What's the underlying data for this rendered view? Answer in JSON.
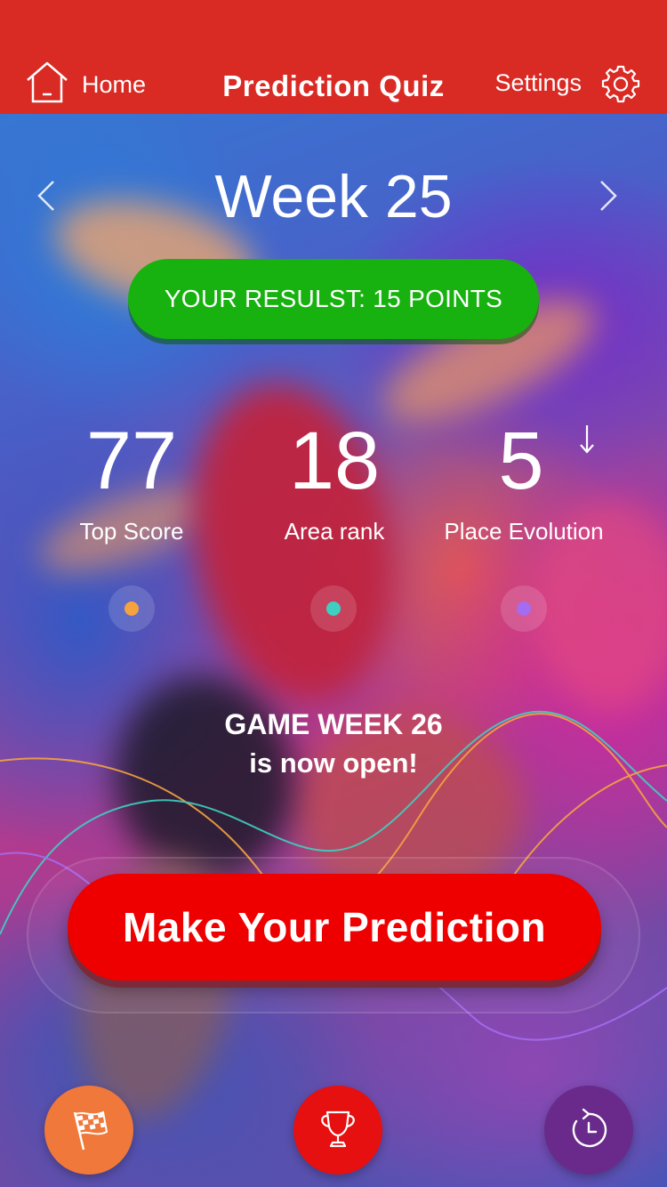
{
  "header": {
    "home_label": "Home",
    "title": "Prediction Quiz",
    "settings_label": "Settings",
    "background_color": "#D92A24"
  },
  "week": {
    "title": "Week 25",
    "result_text": "YOUR RESULST: 15 POINTS",
    "result_color": "#17B20F"
  },
  "stats": [
    {
      "value": "77",
      "label": "Top Score",
      "dot_color": "#F4A340"
    },
    {
      "value": "18",
      "label": "Area rank",
      "dot_color": "#3FCFC0"
    },
    {
      "value": "5",
      "label": "Place Evolution",
      "dot_color": "#A56BF0",
      "trend_icon": "down-arrow-icon"
    }
  ],
  "announcement": {
    "title": "GAME WEEK 26",
    "subtitle": "is now open!"
  },
  "cta": {
    "label": "Make Your Prediction",
    "color": "#EE0000"
  },
  "bottom_nav": [
    {
      "icon": "checkered-flag-icon",
      "color": "#F0783A"
    },
    {
      "icon": "trophy-icon",
      "color": "#E5100F"
    },
    {
      "icon": "history-icon",
      "color": "#6A2A8C"
    }
  ]
}
